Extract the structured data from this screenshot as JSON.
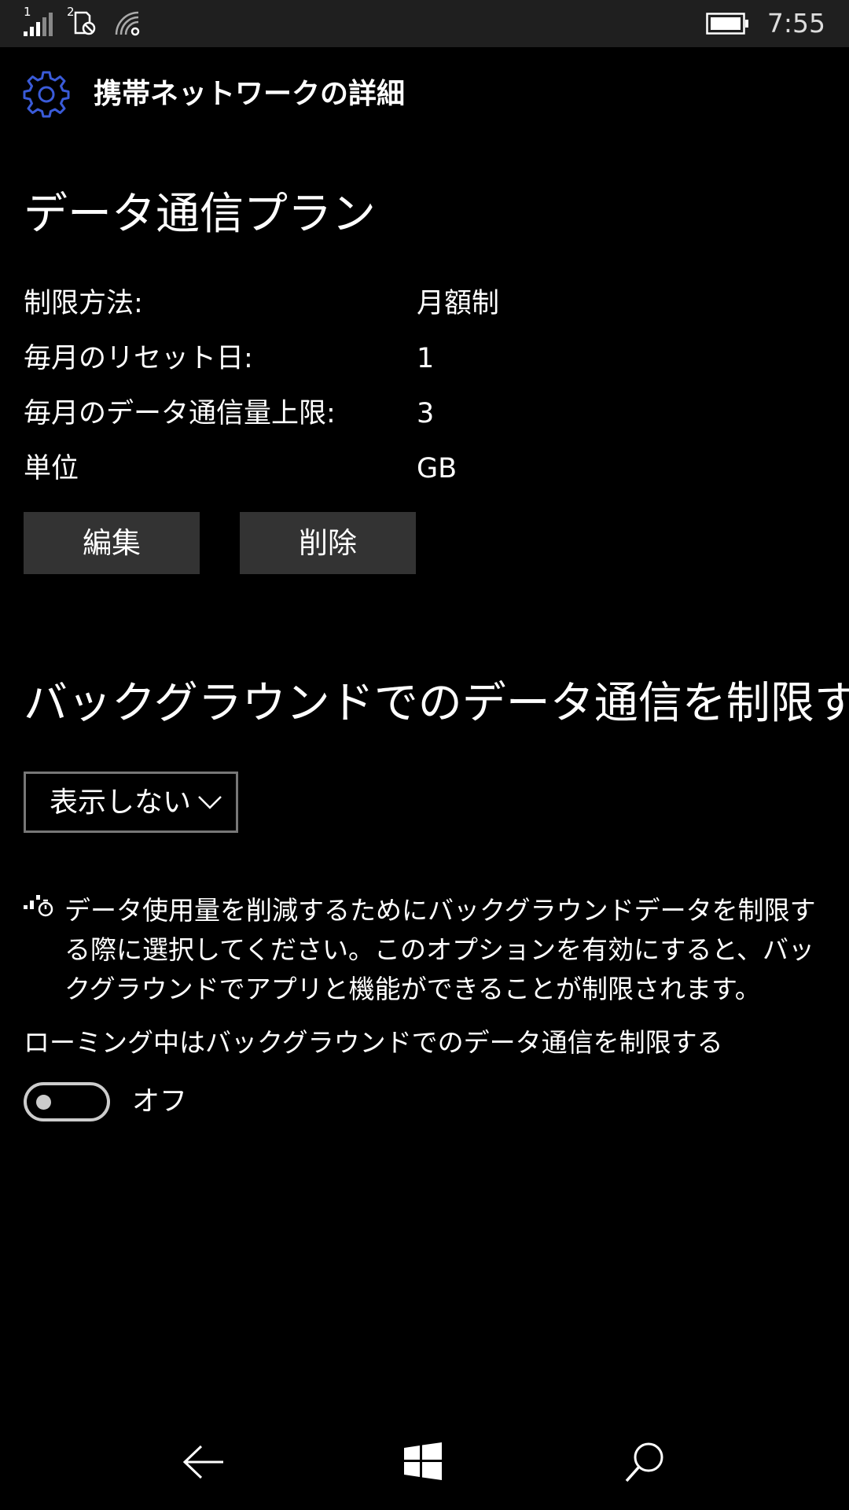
{
  "status_bar": {
    "sim1_label": "1",
    "sim2_label": "2",
    "time": "7:55",
    "icons": [
      "signal-bars-icon",
      "sim2-no-signal-icon",
      "wifi-icon",
      "battery-icon"
    ]
  },
  "header": {
    "icon": "gear-icon",
    "icon_color": "#3a5bd9",
    "title": "携帯ネットワークの詳細"
  },
  "data_plan": {
    "title": "データ通信プラン",
    "rows": [
      {
        "label": "制限方法:",
        "value": "月額制"
      },
      {
        "label": "毎月のリセット日:",
        "value": "1"
      },
      {
        "label": "毎月のデータ通信量上限:",
        "value": "3"
      },
      {
        "label": "単位",
        "value": "GB"
      }
    ],
    "edit_label": "編集",
    "delete_label": "削除"
  },
  "background": {
    "title": "バックグラウンドでのデータ通信を制限する",
    "dropdown_value": "表示しない",
    "info_icon": "data-saver-icon",
    "info_text": "データ使用量を削減するためにバックグラウンドデータを制限する際に選択してください。このオプションを有効にすると、バックグラウンドでアプリと機能ができることが制限されます。"
  },
  "roaming": {
    "label": "ローミング中はバックグラウンドでのデータ通信を制限する",
    "toggle_state": "オフ",
    "toggle_on": false
  },
  "nav_bar": {
    "icons": [
      "back-arrow-icon",
      "windows-logo-icon",
      "search-icon"
    ]
  }
}
